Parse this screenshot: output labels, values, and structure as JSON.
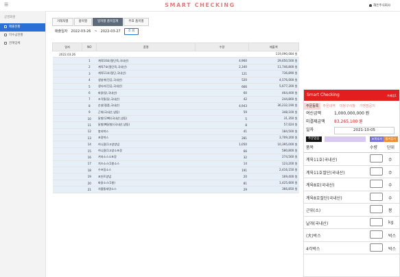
{
  "app": {
    "brand": "SMART CHECKING",
    "user": "해든주식회사"
  },
  "sidebar": {
    "header": "공영회원",
    "items": [
      {
        "label": "매출현황",
        "active": true
      },
      {
        "label": "미수금현황",
        "active": false
      },
      {
        "label": "관계업체",
        "active": false
      }
    ]
  },
  "tabs": [
    {
      "label": "거래처별",
      "active": false
    },
    {
      "label": "품목별",
      "active": false
    },
    {
      "label": "일자별 품목집계",
      "active": true
    },
    {
      "label": "주표 품목별",
      "active": false
    }
  ],
  "filter": {
    "label": "매출일자",
    "from": "2022-03-26",
    "sep": "~",
    "to": "2022-03-27",
    "search": "조 회"
  },
  "table": {
    "headers": [
      "일자",
      "NO",
      "품명",
      "수량",
      "매출액"
    ],
    "total": {
      "date": "2022.03.26",
      "amount": "119,090,084 원"
    },
    "rows": [
      {
        "no": "1",
        "name": "계육10호(절단육,국내산)",
        "qty": "4,960",
        "amt": "29,650,500 원"
      },
      {
        "no": "2",
        "name": "계육7호(절단육,국내산)",
        "qty": "2,340",
        "amt": "11,746,800 원"
      },
      {
        "no": "3",
        "name": "계육11호(절단,국내산)",
        "qty": "121",
        "amt": "736,890 원"
      },
      {
        "no": "4",
        "name": "생날개(진공,국내산)",
        "qty": "520",
        "amt": "4,576,000 원"
      },
      {
        "no": "5",
        "name": "생다리(진공,국내산)",
        "qty": "666",
        "amt": "5,677,200 원"
      },
      {
        "no": "6",
        "name": "파닭(닭,국내산)",
        "qty": "60",
        "amt": "464,400 원"
      },
      {
        "no": "7",
        "name": "조각통(닭,국내산)",
        "qty": "42",
        "amt": "244,860 원"
      },
      {
        "no": "8",
        "name": "순살(절품,국내산)",
        "qty": "4,943",
        "amt": "36,232,190 원"
      },
      {
        "no": "9",
        "name": "근위(국내산,냉동)",
        "qty": "59",
        "amt": "348,100 원"
      },
      {
        "no": "10",
        "name": "닭발(무뼈)(국내산,냉동)",
        "qty": "5",
        "amt": "31,350 원"
      },
      {
        "no": "11",
        "name": "닭발(뼈닭발)(국내산,냉동)",
        "qty": "8",
        "amt": "57,024 원"
      },
      {
        "no": "12",
        "name": "봉지박스",
        "qty": "41",
        "amt": "184,500 원"
      },
      {
        "no": "13",
        "name": "포장박스",
        "qty": "281",
        "amt": "3,709,200 원"
      },
      {
        "no": "14",
        "name": "허니콤(1고양양념",
        "qty": "1,050",
        "amt": "10,395,000 원"
      },
      {
        "no": "15",
        "name": "허니콤(1고양소포장",
        "qty": "66",
        "amt": "580,800 원"
      },
      {
        "no": "16",
        "name": "겨자소스소포장",
        "qty": "32",
        "amt": "274,560 원"
      },
      {
        "no": "17",
        "name": "치즈소스(1봉소스",
        "qty": "14",
        "amt": "123,200 원"
      },
      {
        "no": "18",
        "name": "수프링소스",
        "qty": "191",
        "amt": "2,416,150 원"
      },
      {
        "no": "19",
        "name": "포인트양념",
        "qty": "20",
        "amt": "169,400 원"
      },
      {
        "no": "20",
        "name": "파닭소스(1봉)",
        "qty": "81",
        "amt": "1,425,600 원"
      },
      {
        "no": "21",
        "name": "치즐통새맛소스",
        "qty": "29",
        "amt": "366,850 원"
      }
    ]
  },
  "mobile": {
    "title": "Smart Checking",
    "subtitle": "거래업1",
    "tabs": [
      {
        "label": "주문등록",
        "active": true
      },
      {
        "label": "주문내역",
        "active": false
      },
      {
        "label": "미청구사항",
        "active": false
      },
      {
        "label": "가맹점공지",
        "active": false
      }
    ],
    "credit_label": "여신금액",
    "credit_value": "1,000,000,000 원",
    "unpaid_label": "미결제금액",
    "unpaid_value": "83,265,100 원",
    "date_label": "일자",
    "date_value": "2021-10-05",
    "btn_order": "주문업음",
    "btn_add": "조목추가",
    "btn_fav": "즐겨찾기",
    "list_header": {
      "item": "품목",
      "qty": "수량",
      "unit": "단위"
    },
    "items": [
      {
        "name": "계육11호(국내산)",
        "unit": "수"
      },
      {
        "name": "계육11호절단(국내산)",
        "unit": "수"
      },
      {
        "name": "계육8호(국내산)",
        "unit": "수"
      },
      {
        "name": "계육8호절단(국내산)",
        "unit": "수"
      },
      {
        "name": "근위(소)",
        "unit": "봉"
      },
      {
        "name": "날개(국내산)",
        "unit": "kg"
      },
      {
        "name": "(大)박스",
        "unit": "박스"
      },
      {
        "name": "4각박스",
        "unit": "박스"
      }
    ]
  }
}
